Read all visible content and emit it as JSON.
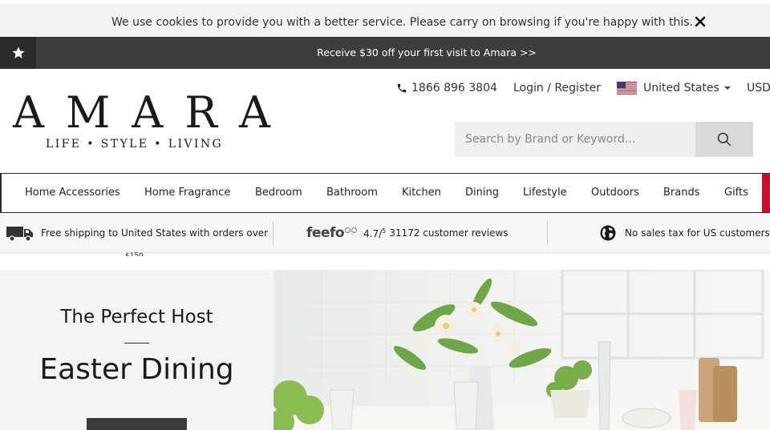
{
  "cookie": {
    "text": "We use cookies to provide you with a better service. Please carry on browsing if you're happy with this."
  },
  "promo": {
    "text": "Receive $30 off your first visit to Amara >>"
  },
  "header": {
    "logo_word": "AMARA",
    "logo_tagline": "LIFE • STYLE • LIVING",
    "phone": "1866 896 3804",
    "login": "Login / Register",
    "country": "United States",
    "currency": "USD",
    "search_placeholder": "Search by Brand or Keyword..."
  },
  "nav": {
    "items": [
      "Home Accessories",
      "Home Fragrance",
      "Bedroom",
      "Bathroom",
      "Kitchen",
      "Dining",
      "Lifestyle",
      "Outdoors",
      "Brands",
      "Gifts"
    ]
  },
  "usp": {
    "shipping": "Free shipping to United States with orders over",
    "shipping_overflow": "$150",
    "feefo_brand": "feefo",
    "rating": "4.7/",
    "rating_max": "5",
    "reviews": "31172 customer reviews",
    "tax": "No sales tax for US customers"
  },
  "hero": {
    "subtitle": "The Perfect Host",
    "title": "Easter Dining"
  },
  "colors": {
    "promo_bg": "#3d3d3d",
    "accent_red": "#c8102e",
    "hero_panel": "#f4f4f4"
  }
}
